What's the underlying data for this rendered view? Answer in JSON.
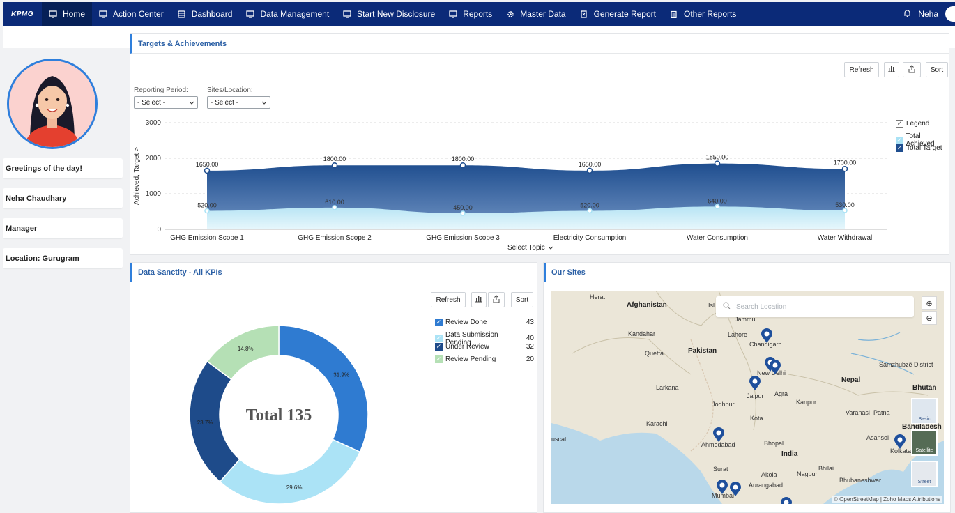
{
  "nav": {
    "logo": "KPMG",
    "items": [
      {
        "label": "Home",
        "icon": "monitor-icon"
      },
      {
        "label": "Action Center",
        "icon": "monitor-icon"
      },
      {
        "label": "Dashboard",
        "icon": "database-icon"
      },
      {
        "label": "Data Management",
        "icon": "monitor-icon"
      },
      {
        "label": "Start New Disclosure",
        "icon": "monitor-icon"
      },
      {
        "label": "Reports",
        "icon": "monitor-icon"
      },
      {
        "label": "Master Data",
        "icon": "gear-icon"
      },
      {
        "label": "Generate Report",
        "icon": "report-icon"
      },
      {
        "label": "Other Reports",
        "icon": "clipboard-icon"
      }
    ],
    "user": "Neha"
  },
  "profile": {
    "greeting": "Greetings of the day!",
    "name": "Neha Chaudhary",
    "role": "Manager",
    "location": "Location: Gurugram"
  },
  "targets_panel": {
    "title": "Targets & Achievements",
    "refresh": "Refresh",
    "sort": "Sort",
    "reporting_period_label": "Reporting Period:",
    "reporting_period_value": "- Select -",
    "sites_label": "Sites/Location:",
    "sites_value": "- Select -",
    "legend_title": "Legend",
    "x_selector": "Select Topic",
    "colors": {
      "target": "#1f4e8f",
      "achieved": "#a9e2f5"
    }
  },
  "chart_data": [
    {
      "type": "area",
      "categories": [
        "GHG Emission Scope 1",
        "GHG Emission Scope 2",
        "GHG Emission Scope 3",
        "Electricity Consumption",
        "Water Consumption",
        "Water Withdrawal"
      ],
      "series": [
        {
          "name": "Total Target",
          "values": [
            1650,
            1800,
            1800,
            1650,
            1850,
            1700
          ]
        },
        {
          "name": "Total Achieved",
          "values": [
            520,
            610,
            450,
            520,
            640,
            530
          ]
        }
      ],
      "value_labels": {
        "target": [
          "1650.00",
          "1800.00",
          "1800.00",
          "1650.00",
          "1850.00",
          "1700.00"
        ],
        "achieved": [
          "520.00",
          "610.00",
          "450.00",
          "520.00",
          "640.00",
          "530.00"
        ]
      },
      "ylabel": "Achieved, Target",
      "yticks": [
        "0",
        "1000",
        "2000",
        "3000"
      ],
      "ylim": [
        0,
        3000
      ],
      "grid": true,
      "legend": "right"
    },
    {
      "type": "pie",
      "center_label": "Total 135",
      "slices": [
        {
          "name": "Review Done",
          "value": 43,
          "percent": "31.9%",
          "color": "#2f7bd1"
        },
        {
          "name": "Data Submission Pending",
          "value": 40,
          "percent": "29.6%",
          "color": "#abe3f6"
        },
        {
          "name": "Under Review",
          "value": 32,
          "percent": "23.7%",
          "color": "#1e4b8a"
        },
        {
          "name": "Review Pending",
          "value": 20,
          "percent": "14.8%",
          "color": "#b5e0b5"
        }
      ],
      "legend": "right"
    }
  ],
  "sanctity_panel": {
    "title": "Data Sanctity - All KPIs",
    "refresh": "Refresh",
    "sort": "Sort"
  },
  "sites_panel": {
    "title": "Our Sites",
    "search_placeholder": "Search Location",
    "attribution": "© OpenStreetMap | Zoho Maps Attributions",
    "layers": [
      "Basic",
      "Satellite",
      "Street"
    ],
    "labels": [
      "Herat",
      "Afghanistan",
      "Isl",
      "Jammu",
      "Kandahar",
      "Lahore",
      "Chandigarh",
      "Quetta",
      "Pakistan",
      "New Delhi",
      "Samzhubzê District",
      "Nepal",
      "Bhutan",
      "Larkana",
      "Jaipur",
      "Agra",
      "Kanpur",
      "Jodhpur",
      "Kota",
      "Varanasi",
      "Patna",
      "Karachi",
      "Bangladesh",
      "Asansol",
      "Ahmedabad",
      "Bhopal",
      "Kolkata",
      "uscat",
      "India",
      "Surat",
      "Nagpur",
      "Bhilai",
      "Akola",
      "Bhubaneshwar",
      "Aurangabad",
      "Mumbai"
    ]
  }
}
